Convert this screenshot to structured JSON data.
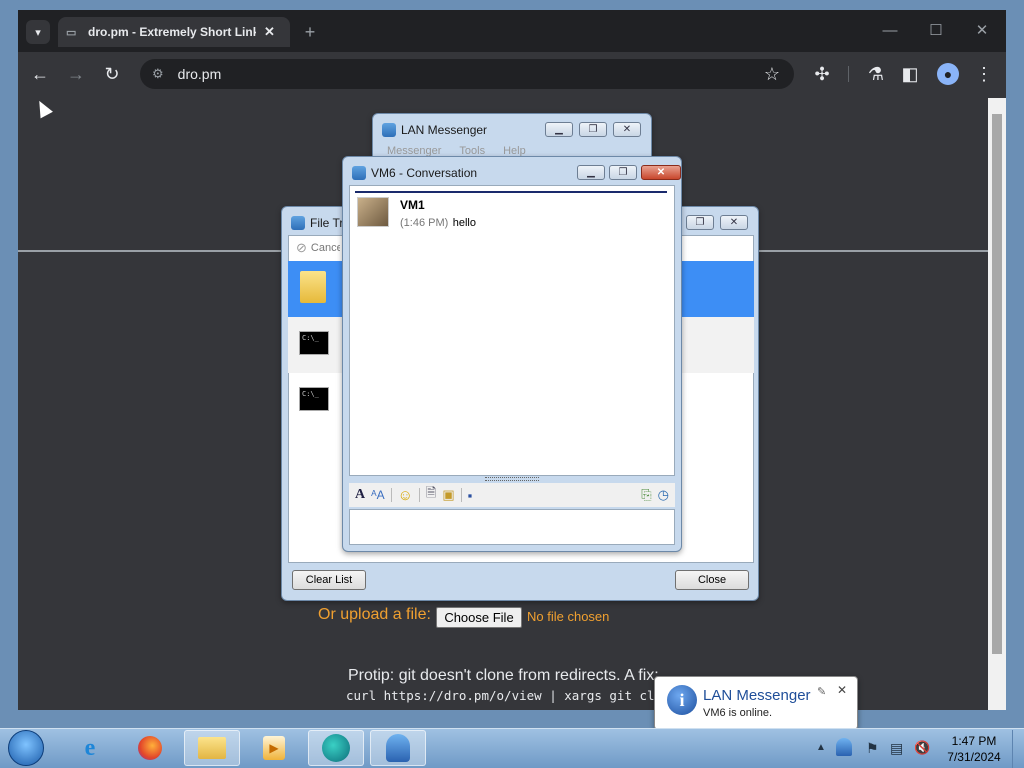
{
  "browser": {
    "tab_title": "dro.pm - Extremely Short Links",
    "tab_close": "✕",
    "new_tab": "+",
    "url": "dro.pm",
    "win_min": "—",
    "win_max": "☐",
    "win_close": "✕"
  },
  "page": {
    "upload_label": "Or upload a file:",
    "choose_file": "Choose File",
    "no_file": "No file chosen",
    "protip": "Protip: git doesn't clone from redirects. A fix:",
    "curl": "curl https://dro.pm/o/view | xargs git clone"
  },
  "messenger": {
    "title": "LAN Messenger",
    "menu": [
      "Messenger",
      "Tools",
      "Help"
    ]
  },
  "file_transfer": {
    "title": "File Transfers",
    "cancel": "Cancel",
    "clear_list": "Clear List",
    "close": "Close"
  },
  "conversation": {
    "title": "VM6 - Conversation",
    "sender": "VM1",
    "time": "(1:46 PM)",
    "message": "hello"
  },
  "toast": {
    "title": "LAN Messenger",
    "body": "VM6 is online."
  },
  "clock": {
    "time": "1:47 PM",
    "date": "7/31/2024"
  },
  "colors": {
    "chrome_dark": "#202124",
    "selection_blue": "#3d8ef5",
    "upload_orange": "#f0a030"
  }
}
